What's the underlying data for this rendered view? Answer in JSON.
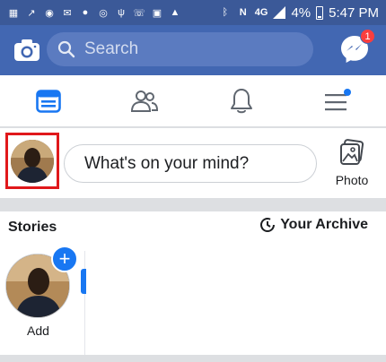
{
  "status_bar": {
    "battery": "4%",
    "time": "5:47 PM",
    "network": "4G"
  },
  "top_bar": {
    "search_placeholder": "Search",
    "messenger_badge": "1"
  },
  "composer": {
    "placeholder": "What's on your mind?",
    "photo_label": "Photo"
  },
  "stories": {
    "title": "Stories",
    "archive_label": "Your Archive",
    "add_label": "Add"
  },
  "colors": {
    "brand": "#4267b2",
    "status_bar": "#3b5998",
    "accent_blue": "#1877f2",
    "highlight_red": "#e0181b",
    "badge_red": "#fa3e3e"
  },
  "icons": [
    "camera-icon",
    "search-icon",
    "messenger-icon",
    "news-feed-icon",
    "friends-icon",
    "notifications-icon",
    "menu-icon",
    "photo-icon",
    "archive-clock-icon",
    "plus-icon"
  ]
}
